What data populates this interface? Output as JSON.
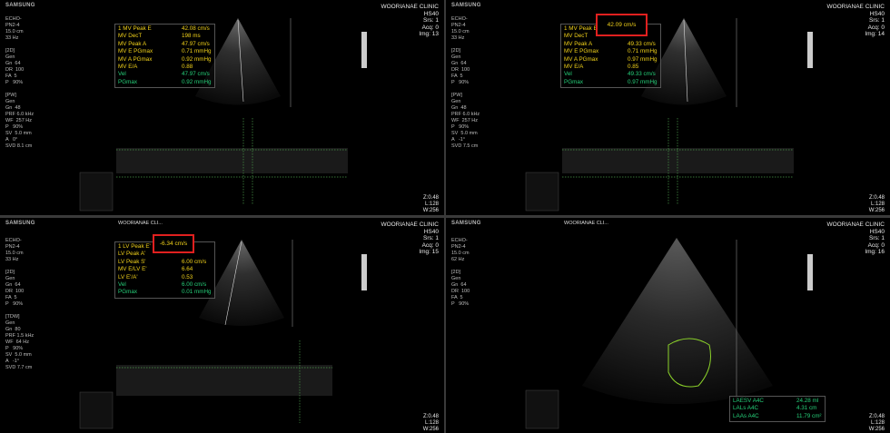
{
  "panels": [
    {
      "brand": "SAMSUNG",
      "clinic": "WOORIANAE CLINIC",
      "probe": "HS40",
      "srs": "Srs: 1",
      "acq": "Acq: 0",
      "img": "Img: 13",
      "sidebar": "ECHO-\nPN2-4\n15.0 cm\n33 Hz\n\n[2D]\nGen\nGn  64\nDR  100\nFA  5\nP   90%\n\n[PW]\nGen\nGn  48\nPRF 6.0 kHz\nWF  257 Hz\nP   90%\nSV  5.0 mm\nA   0°\nSVD 8.1 cm",
      "zlw": [
        "Z:0.48",
        "L:128",
        "W:256"
      ],
      "measurements": [
        {
          "label": "1 MV Peak E",
          "value": "42.08 cm/s",
          "color": "#f2d21a"
        },
        {
          "label": "MV DecT",
          "value": "198 ms",
          "color": "#f2d21a"
        },
        {
          "label": "MV Peak A",
          "value": "47.97 cm/s",
          "color": "#f2d21a"
        },
        {
          "label": "MV E PGmax",
          "value": "0.71 mmHg",
          "color": "#f2d21a"
        },
        {
          "label": "MV A PGmax",
          "value": "0.92 mmHg",
          "color": "#f2d21a"
        },
        {
          "label": "MV E/A",
          "value": "0.88",
          "color": "#f2d21a"
        },
        {
          "label": "Vel",
          "value": "47.97 cm/s",
          "color": "#26d17a"
        },
        {
          "label": "PGmax",
          "value": "0.92 mmHg",
          "color": "#26d17a"
        }
      ]
    },
    {
      "brand": "SAMSUNG",
      "clinic": "WOORIANAE CLINIC",
      "probe": "HS40",
      "srs": "Srs: 1",
      "acq": "Acq: 0",
      "img": "Img: 14",
      "sidebar": "ECHO-\nPN2-4\n15.0 cm\n33 Hz\n\n[2D]\nGen\nGn  64\nDR  100\nFA  5\nP   90%\n\n[PW]\nGen\nGn  48\nPRF 6.0 kHz\nWF  257 Hz\nP   90%\nSV  5.0 mm\nA   -1°\nSVD 7.5 cm",
      "zlw": [
        "Z:0.48",
        "L:128",
        "W:256"
      ],
      "highlight": "42.09 cm/s",
      "measurements": [
        {
          "label": "1 MV Peak E",
          "value": "",
          "color": "#f2d21a"
        },
        {
          "label": "MV DecT",
          "value": "",
          "color": "#f2d21a"
        },
        {
          "label": "MV Peak A",
          "value": "49.33 cm/s",
          "color": "#f2d21a"
        },
        {
          "label": "MV E PGmax",
          "value": "0.71 mmHg",
          "color": "#f2d21a"
        },
        {
          "label": "MV A PGmax",
          "value": "0.97 mmHg",
          "color": "#f2d21a"
        },
        {
          "label": "MV E/A",
          "value": "0.85",
          "color": "#f2d21a"
        },
        {
          "label": "Vel",
          "value": "49.33 cm/s",
          "color": "#26d17a"
        },
        {
          "label": "PGmax",
          "value": "0.97 mmHg",
          "color": "#26d17a"
        }
      ]
    },
    {
      "brand": "SAMSUNG",
      "clinic_small": "WOORIANAE CLI...",
      "clinic": "WOORIANAE CLINIC",
      "probe": "HS40",
      "srs": "Srs: 1",
      "acq": "Acq: 0",
      "img": "Img: 15",
      "sidebar": "ECHO-\nPN2-4\n15.0 cm\n33 Hz\n\n[2D]\nGen\nGn  64\nDR  100\nFA  5\nP   90%\n\n[TDW]\nGen\nGn  80\nPRF 1.5 kHz\nWF  64 Hz\nP   90%\nSV  5.0 mm\nA   -1°\nSVD 7.7 cm",
      "zlw": [
        "Z:0.48",
        "L:128",
        "W:256"
      ],
      "highlight": "-6.34 cm/s",
      "measurements": [
        {
          "label": "1 LV Peak E'",
          "value": "",
          "color": "#f2d21a"
        },
        {
          "label": "LV Peak A'",
          "value": "",
          "color": "#f2d21a"
        },
        {
          "label": "LV Peak S'",
          "value": "6.00 cm/s",
          "color": "#f2d21a"
        },
        {
          "label": "MV E/LV E'",
          "value": "6.64",
          "color": "#f2d21a"
        },
        {
          "label": "LV E'/A'",
          "value": "0.53",
          "color": "#f2d21a"
        },
        {
          "label": "Vel",
          "value": "6.00 cm/s",
          "color": "#26d17a"
        },
        {
          "label": "PGmax",
          "value": "0.01 mmHg",
          "color": "#26d17a"
        }
      ]
    },
    {
      "brand": "SAMSUNG",
      "clinic_small": "WOORIANAE CLI...",
      "clinic": "WOORIANAE CLINIC",
      "probe": "HS40",
      "srs": "Srs: 1",
      "acq": "Acq: 0",
      "img": "Img: 16",
      "sidebar": "ECHO-\nPN2-4\n15.0 cm\n62 Hz\n\n[2D]\nGen\nGn  64\nDR  100\nFA  5\nP   90%",
      "zlw": [
        "Z:0.48",
        "L:128",
        "W:256"
      ],
      "measurements": [
        {
          "label": "LAESV A4C",
          "value": "24.28 ml",
          "color": "#26d17a"
        },
        {
          "label": "LALs A4C",
          "value": "4.31 cm",
          "color": "#26d17a"
        },
        {
          "label": "LAAs A4C",
          "value": "11.79 cm²",
          "color": "#26d17a"
        }
      ]
    }
  ]
}
